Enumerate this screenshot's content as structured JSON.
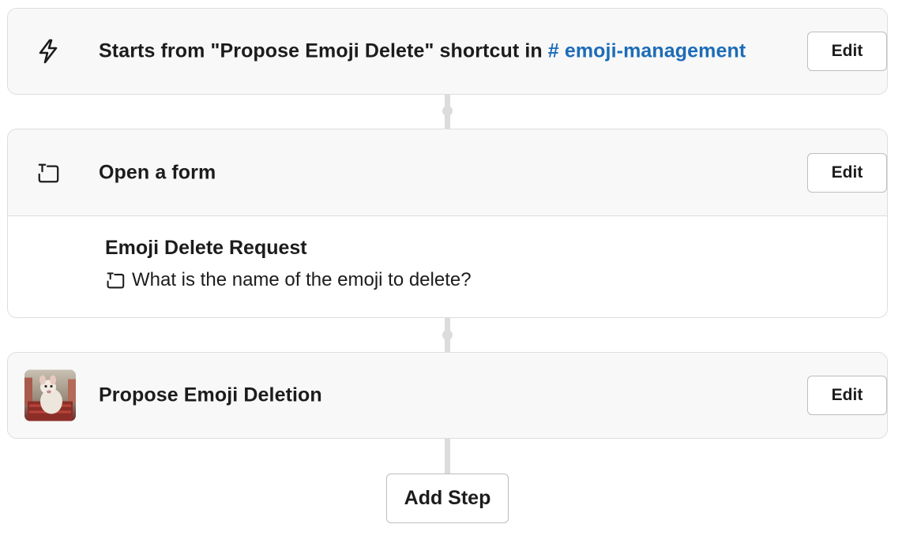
{
  "steps": [
    {
      "icon": "lightning-icon",
      "title_prefix": "Starts from \"Propose Emoji Delete\" shortcut in ",
      "channel": "# emoji-management",
      "edit_label": "Edit"
    },
    {
      "icon": "form-icon",
      "title": "Open a form",
      "edit_label": "Edit",
      "form": {
        "name": "Emoji Delete Request",
        "question_icon": "form-icon",
        "question": "What is the name of the emoji to delete?"
      }
    },
    {
      "icon": "app-avatar",
      "title": "Propose Emoji Deletion",
      "edit_label": "Edit"
    }
  ],
  "add_step_label": "Add Step"
}
